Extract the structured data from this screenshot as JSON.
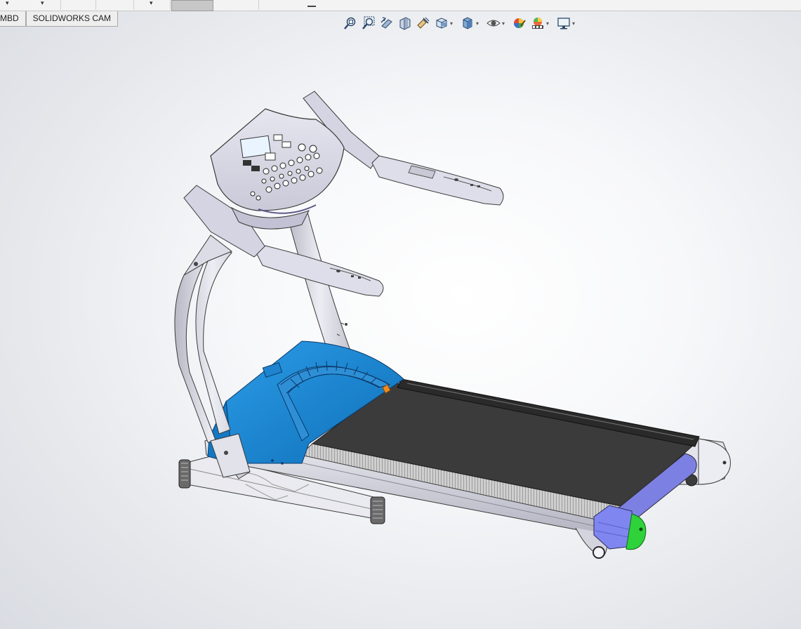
{
  "tabs": [
    {
      "label": "MBD"
    },
    {
      "label": "SOLIDWORKS CAM"
    }
  ],
  "heads_up_toolbar": [
    {
      "icon": "zoom-to-fit-icon",
      "dropdown": false
    },
    {
      "icon": "zoom-to-area-icon",
      "dropdown": false
    },
    {
      "icon": "previous-view-icon",
      "dropdown": false
    },
    {
      "icon": "section-view-icon",
      "dropdown": false
    },
    {
      "icon": "dynamic-annotation-views-icon",
      "dropdown": false
    },
    {
      "icon": "view-orientation-icon",
      "dropdown": true
    },
    {
      "icon": "display-style-icon",
      "dropdown": true
    },
    {
      "icon": "hide-show-items-icon",
      "dropdown": true
    },
    {
      "icon": "edit-appearance-icon",
      "dropdown": false
    },
    {
      "icon": "apply-scene-icon",
      "dropdown": true
    },
    {
      "icon": "view-settings-icon",
      "dropdown": true
    }
  ],
  "model": {
    "name": "treadmill-assembly",
    "colors": {
      "frame": "#d8d8e6",
      "frame_edge": "#3a3a3a",
      "motor_cover": "#1a87d4",
      "belt": "#3b3b3b",
      "end_cap_left": "#7f86f0",
      "end_cap_right": "#2fd23a",
      "roller": "#7c80e2"
    }
  }
}
